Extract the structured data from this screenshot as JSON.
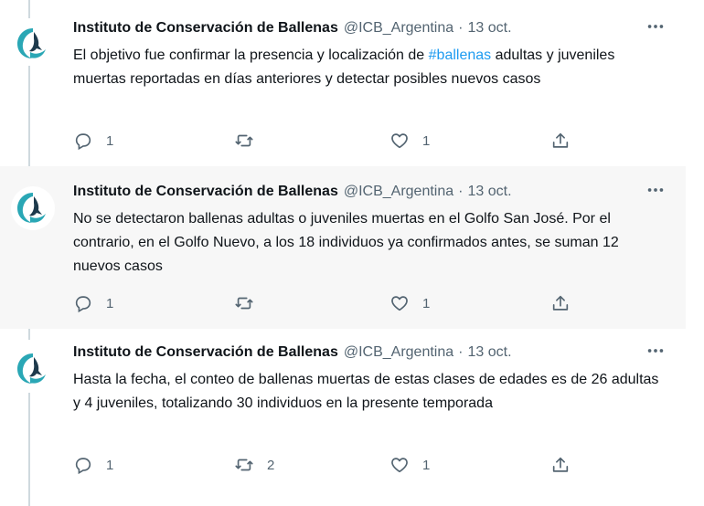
{
  "author": {
    "name": "Instituto de Conservación de Ballenas",
    "handle": "@ICB_Argentina",
    "separator": "·",
    "avatar_icon": "whale-tail-icon"
  },
  "colors": {
    "accent": "#1d9bf0",
    "secondary": "#536471",
    "avatar_teal": "#2aa7b5",
    "avatar_dark": "#1e3a4c"
  },
  "tweets": [
    {
      "date": "13 oct.",
      "text_before": "El objetivo fue confirmar la presencia y localización de ",
      "hashtag": "#ballenas",
      "text_after": " adultas y juveniles muertas reportadas en días anteriores y detectar posibles nuevos casos",
      "replies": "1",
      "retweets": "",
      "likes": "1"
    },
    {
      "date": "13 oct.",
      "text": "No se detectaron ballenas adultas o juveniles muertas en el Golfo San José. Por el contrario, en el Golfo Nuevo, a los 18 individuos ya confirmados antes, se suman 12 nuevos casos",
      "replies": "1",
      "retweets": "",
      "likes": "1"
    },
    {
      "date": "13 oct.",
      "text": "Hasta la fecha, el conteo de ballenas muertas de estas clases de edades es de 26 adultas y 4 juveniles, totalizando 30 individuos en la presente temporada",
      "replies": "1",
      "retweets": "2",
      "likes": "1"
    }
  ]
}
